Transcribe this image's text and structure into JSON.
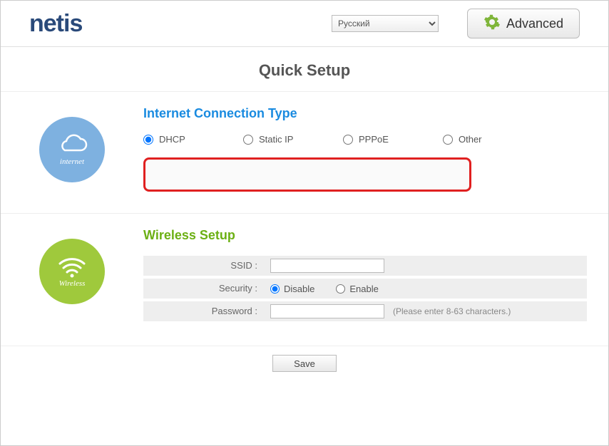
{
  "header": {
    "logo_text": "netis",
    "language": "Русский",
    "advanced_label": "Advanced"
  },
  "page_title": "Quick Setup",
  "internet": {
    "section_title": "Internet Connection Type",
    "icon_caption": "internet",
    "options": {
      "dhcp": "DHCP",
      "static_ip": "Static IP",
      "pppoe": "PPPoE",
      "other": "Other"
    },
    "selected": "dhcp"
  },
  "wireless": {
    "section_title": "Wireless Setup",
    "icon_caption": "Wireless",
    "ssid_label": "SSID :",
    "ssid_value": "",
    "security_label": "Security :",
    "security_disable": "Disable",
    "security_enable": "Enable",
    "security_selected": "disable",
    "password_label": "Password :",
    "password_value": "",
    "password_hint": "(Please enter 8-63 characters.)"
  },
  "footer": {
    "save_label": "Save"
  },
  "colors": {
    "blue_accent": "#1a8be0",
    "green_accent": "#6cb014",
    "internet_bg": "#7eb1e0",
    "wireless_bg": "#9fc93c",
    "highlight_border": "#e02020"
  }
}
